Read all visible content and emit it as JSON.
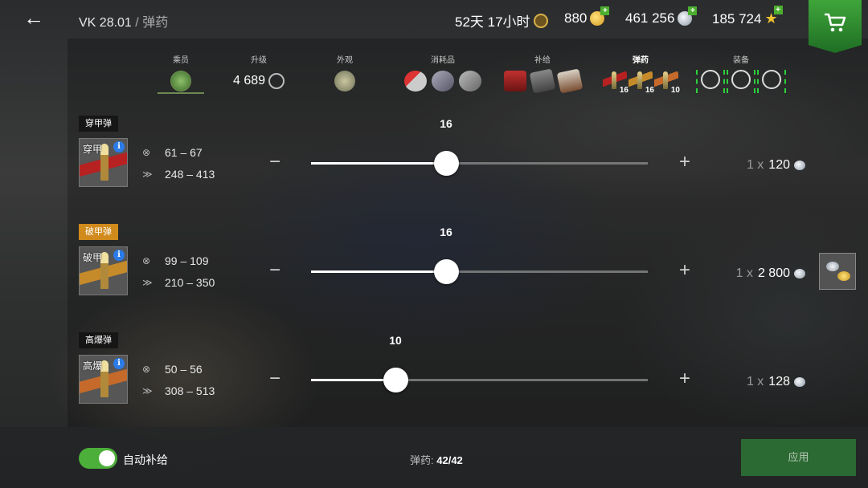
{
  "header": {
    "tank": "VK 28.01",
    "separator": "/",
    "section": "弹药",
    "premium_time": "52天 17小时",
    "gold": "880",
    "silver": "461 256",
    "free_xp": "185 724"
  },
  "tabs": {
    "crew": "乘员",
    "upgrade": "升级",
    "upgrade_value": "4 689",
    "appearance": "外观",
    "consumables": "消耗品",
    "supplies": "补给",
    "ammo": "弹药",
    "ammo_counts": [
      "16",
      "16",
      "10"
    ],
    "equipment": "装备"
  },
  "shells": [
    {
      "tag": "穿甲弹",
      "card_label": "穿甲",
      "damage": "61 – 67",
      "penetration": "248 – 413",
      "count": "16",
      "slider_fraction": 0.4,
      "qty": "1",
      "times": "x",
      "price": "120",
      "band_color": "#b72121"
    },
    {
      "tag": "破甲弹",
      "card_label": "破甲",
      "damage": "99 – 109",
      "penetration": "210 – 350",
      "count": "16",
      "slider_fraction": 0.4,
      "qty": "1",
      "times": "x",
      "price": "2 800",
      "band_color": "#c58a2a"
    },
    {
      "tag": "高爆弹",
      "card_label": "高爆",
      "damage": "50 – 56",
      "penetration": "308 – 513",
      "count": "10",
      "slider_fraction": 0.25,
      "qty": "1",
      "times": "x",
      "price": "128",
      "band_color": "#c56a2a"
    }
  ],
  "footer": {
    "auto_resupply": "自动补给",
    "ammo_label": "弹药:",
    "ammo_total": "42/42",
    "apply": "应用"
  },
  "colors": {
    "accent_green": "#4caf3a",
    "premium_orange": "#d18a1c",
    "apply_green": "#2c6a33"
  }
}
